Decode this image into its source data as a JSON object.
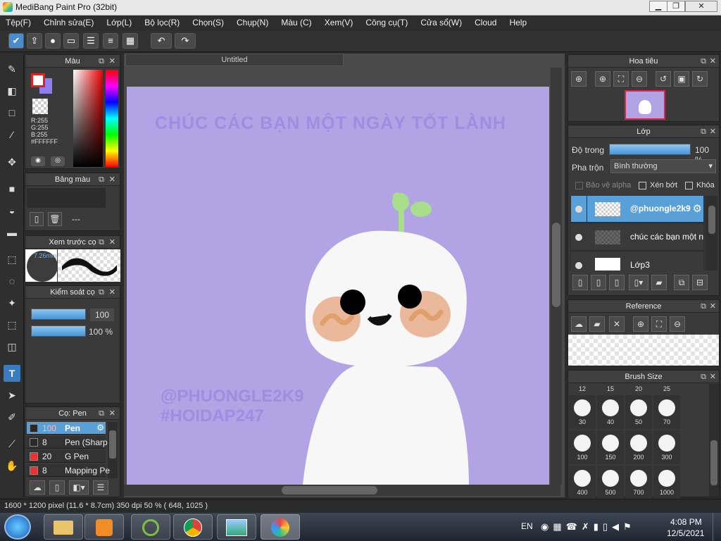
{
  "window": {
    "title": "MediBang Paint Pro (32bit)",
    "min": "▁",
    "max": "❐",
    "close": "✕"
  },
  "menu": [
    "Tệp(F)",
    "Chỉnh sửa(E)",
    "Lớp(L)",
    "Bộ lọc(R)",
    "Chọn(S)",
    "Chụp(N)",
    "Màu (C)",
    "Xem(V)",
    "Công cụ(T)",
    "Cửa sổ(W)",
    "Cloud",
    "Help"
  ],
  "color_panel": {
    "title": "Màu",
    "r": "R:255",
    "g": "G:255",
    "b": "B:255",
    "hex": "#FFFFFF"
  },
  "palette_panel": {
    "title": "Bảng màu",
    "value": "---"
  },
  "brush_preview": {
    "title": "Xem trước cọ",
    "size": "7.26mm"
  },
  "brush_control": {
    "title": "Kiểm soát cọ",
    "size_value": "100",
    "opacity_value": "100 %",
    "size_level": 1.0,
    "opacity_level": 1.0
  },
  "brush_list": {
    "title": "Cọ: Pen",
    "items": [
      {
        "size": "100",
        "name": "Pen",
        "selected": true,
        "color": "#2a2a2a"
      },
      {
        "size": "8",
        "name": "Pen (Sharp",
        "selected": false,
        "color": "#2a2a2a"
      },
      {
        "size": "20",
        "name": "G Pen",
        "selected": false,
        "color": "#e33"
      },
      {
        "size": "8",
        "name": "Mapping Pe",
        "selected": false,
        "color": "#e33"
      }
    ]
  },
  "canvas": {
    "tab": "Untitled",
    "headline": "CHÚC CÁC BẠN MỘT NGÀY TỐT LÀNH",
    "credit1": "@PHUONGLE2K9",
    "credit2": "#HOIDAP247",
    "bg_color": "#b2a3e4",
    "text_color": "#9c8ee0"
  },
  "navigator": {
    "title": "Hoa tiêu"
  },
  "layers": {
    "title": "Lớp",
    "opacity_label": "Độ trong",
    "opacity_value": "100 %",
    "opacity_level": 1.0,
    "blend_label": "Pha trộn",
    "blend_value": "Bình thường",
    "protect_alpha": "Bảo vệ alpha",
    "clipping": "Xén bớt",
    "lock": "Khóa",
    "items": [
      {
        "name": "@phuongle2k9"
      },
      {
        "name": "chúc các bạn một n"
      },
      {
        "name": "Lớp3"
      }
    ]
  },
  "reference": {
    "title": "Reference"
  },
  "brush_size": {
    "title": "Brush Size",
    "header": [
      "12",
      "15",
      "20",
      "25"
    ],
    "rows": [
      [
        "30",
        "40",
        "50",
        "70"
      ],
      [
        "100",
        "150",
        "200",
        "300"
      ],
      [
        "400",
        "500",
        "700",
        "1000"
      ]
    ]
  },
  "status": {
    "text": "1600 * 1200 pixel  (11.6 * 8.7cm)  350 dpi   50 %   ( 648, 1025 )"
  },
  "taskbar": {
    "lang": "EN",
    "time": "4:08 PM",
    "date": "12/5/2021"
  }
}
